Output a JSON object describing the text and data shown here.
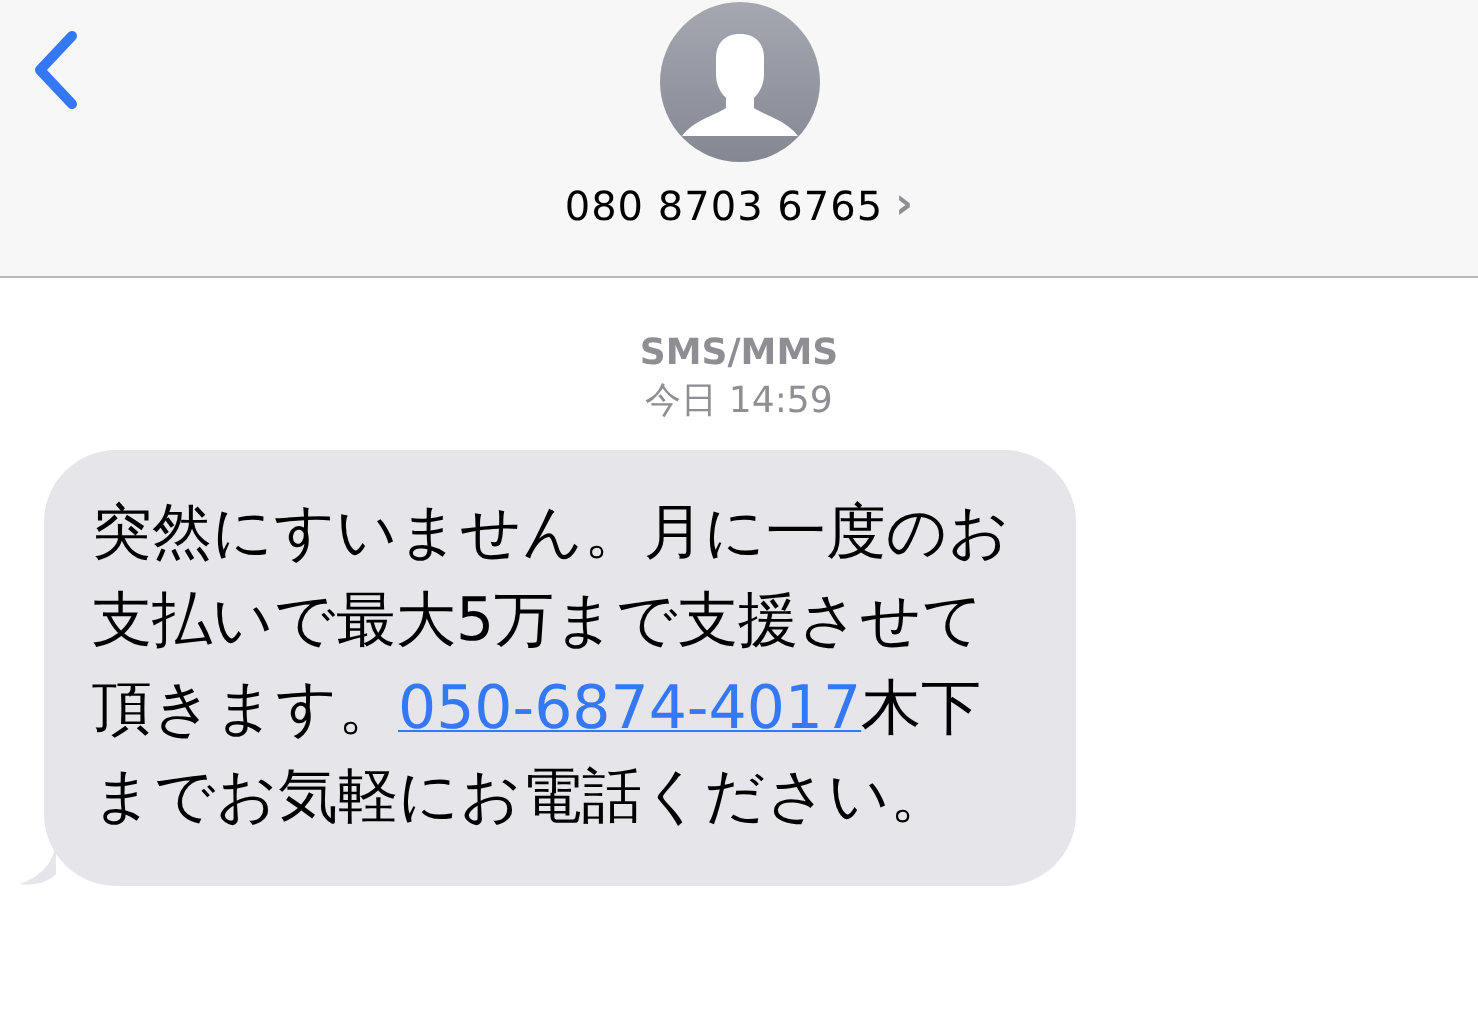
{
  "header": {
    "contact": "080 8703 6765",
    "detail_chevron": "›"
  },
  "conversation": {
    "service": "SMS/MMS",
    "timestamp": "今日 14:59"
  },
  "messages": [
    {
      "incoming": true,
      "parts": [
        {
          "kind": "text",
          "text": "突然にすいません。月に一度のお支払いで最大5万まで支援させて頂きます。"
        },
        {
          "kind": "link",
          "text": "050-6874-4017"
        },
        {
          "kind": "text",
          "text": "木下までお気軽にお電話ください。"
        }
      ]
    }
  ]
}
